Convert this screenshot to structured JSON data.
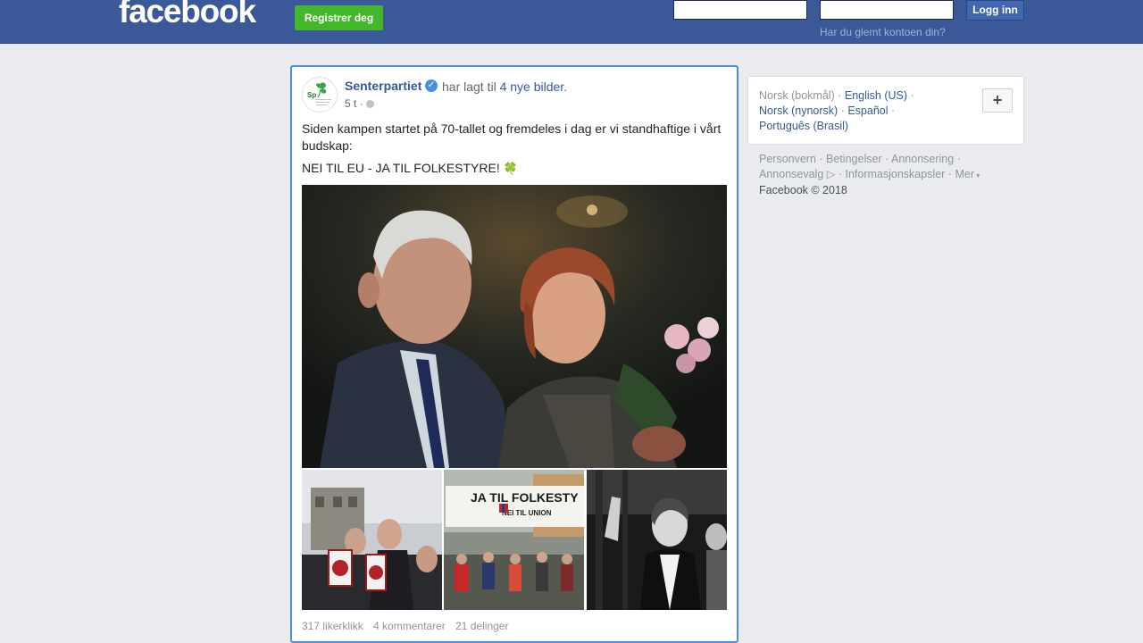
{
  "header": {
    "logo": "facebook",
    "register_label": "Registrer deg",
    "email_value": "",
    "password_value": "",
    "login_label": "Logg inn",
    "forgot_label": "Har du glemt kontoen din?"
  },
  "post": {
    "page_name": "Senterpartiet",
    "action_prefix": "har lagt til",
    "action_link": "4 nye bilder",
    "action_suffix": ".",
    "timestamp": "5 t ·",
    "text_line1": "Siden kampen startet på 70-tallet og fremdeles i dag er vi standhaftige i vårt budskap:",
    "text_line2": "NEI TIL EU - JA TIL FOLKESTYRE!",
    "clover": "🍀",
    "photo2_banner": "JA TIL FOLKESTY",
    "photo2_sub": "NEI TIL UNION",
    "likes": "317 likerklikk",
    "comments": "4 kommentarer",
    "shares": "21 delinger"
  },
  "languages": {
    "current": "Norsk (bokmål)",
    "english": "English (US)",
    "nynorsk": "Norsk (nynorsk)",
    "espanol": "Español",
    "portugues": "Português (Brasil)",
    "plus": "+"
  },
  "footer": {
    "privacy": "Personvern",
    "terms": "Betingelser",
    "advertising": "Annonsering",
    "ad_choices": "Annonsevalg",
    "cookies": "Informasjonskapsler",
    "more": "Mer",
    "copyright": "Facebook © 2018"
  },
  "colors": {
    "topbar": "#3b5998",
    "link": "#365899",
    "register_green": "#42b72a",
    "focus_border": "#4a90e2"
  }
}
